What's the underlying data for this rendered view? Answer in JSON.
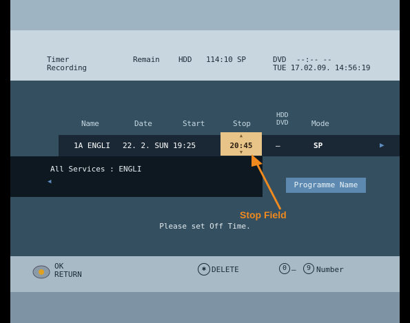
{
  "header": {
    "title": "Timer Recording",
    "title_line1": "Timer",
    "title_line2": "Recording",
    "remain_label": "Remain",
    "hdd_label": "HDD",
    "hdd_remain": "114:10 SP",
    "dvd_label": "DVD",
    "dvd_remain": "--:-- --",
    "datetime": "TUE 17.02.09. 14:56:19"
  },
  "table": {
    "columns": [
      "Name",
      "Date",
      "Start",
      "Stop",
      "HDD DVD",
      "Mode"
    ],
    "col_name": "Name",
    "col_date": "Date",
    "col_start": "Start",
    "col_stop": "Stop",
    "col_dest_top": "HDD",
    "col_dest_bottom": "DVD",
    "col_mode": "Mode",
    "row": {
      "name": "1A ENGLI",
      "date": "22. 2. SUN",
      "start": "19:25",
      "stop": "20:45",
      "dest": "—",
      "mode": "SP"
    }
  },
  "services": {
    "text": "All Services : ENGLI"
  },
  "programme_name_button": "Programme Name",
  "message": "Please set Off Time.",
  "callout": "Stop Field",
  "footer": {
    "ok": "OK",
    "return": "RETURN",
    "delete": "DELETE",
    "number_from": "0",
    "number_to": "9",
    "number_label": "Number"
  },
  "colors": {
    "accent": "#f08a1e",
    "selected_cell": "#e8c488",
    "button": "#5d89b0"
  }
}
